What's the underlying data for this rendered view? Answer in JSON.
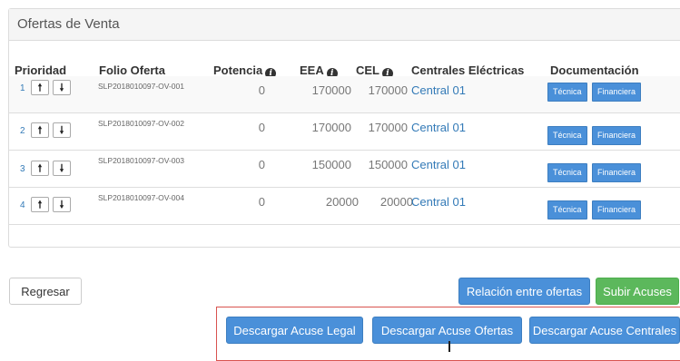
{
  "panel": {
    "title": "Ofertas de Venta"
  },
  "columns": {
    "prioridad": "Prioridad",
    "folio": "Folio Oferta",
    "potencia": "Potencia",
    "eea": "EEA",
    "cel": "CEL",
    "centrales": "Centrales Eléctricas",
    "documentacion": "Documentación"
  },
  "info_icon": "info-circle-icon",
  "rows": [
    {
      "prioridad": "1",
      "folio": "SLP2018010097-OV-001",
      "potencia": "0",
      "eea": "170000",
      "cel": "170000",
      "central": "Central 01",
      "tecnica": "Técnica",
      "financiera": "Financiera"
    },
    {
      "prioridad": "2",
      "folio": "SLP2018010097-OV-002",
      "potencia": "0",
      "eea": "170000",
      "cel": "170000",
      "central": "Central 01",
      "tecnica": "Técnica",
      "financiera": "Financiera"
    },
    {
      "prioridad": "3",
      "folio": "SLP2018010097-OV-003",
      "potencia": "0",
      "eea": "150000",
      "cel": "150000",
      "central": "Central 01",
      "tecnica": "Técnica",
      "financiera": "Financiera"
    },
    {
      "prioridad": "4",
      "folio": "SLP2018010097-OV-004",
      "potencia": "0",
      "eea": "20000",
      "cel": "20000",
      "central": "Central 01",
      "tecnica": "Técnica",
      "financiera": "Financiera"
    }
  ],
  "arrows": {
    "up": "🠕",
    "down": "🠗"
  },
  "buttons": {
    "regresar": "Regresar",
    "relacion": "Relación entre ofertas",
    "subir": "Subir Acuses",
    "acuse_legal": "Descargar Acuse Legal",
    "acuse_ofertas": "Descargar Acuse Ofertas",
    "acuse_centrales": "Descargar Acuse Centrales"
  },
  "colors": {
    "primary": "#4a90d9",
    "success": "#5cb85c",
    "highlight_border": "#d9534f",
    "link": "#337ab7"
  }
}
